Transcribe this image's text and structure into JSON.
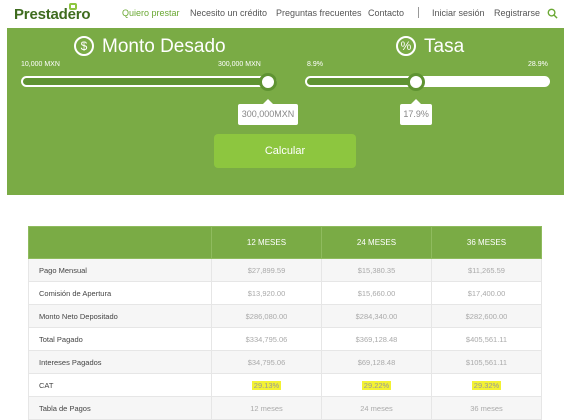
{
  "nav": {
    "logo": "Prestadero",
    "links": [
      "Quiero prestar",
      "Necesito un crédito",
      "Preguntas frecuentes",
      "Contacto"
    ],
    "login": "Iniciar sesión",
    "register": "Registrarse"
  },
  "monto": {
    "title": "Monto Desado",
    "min_label": "10,000 MXN",
    "max_label": "300,000 MXN",
    "value": "300,000MXN",
    "level": 1.0
  },
  "tasa": {
    "title": "Tasa",
    "min_label": "8.9%",
    "max_label": "28.9%",
    "value": "17.9%",
    "level": 0.45
  },
  "calculate_label": "Calcular",
  "table": {
    "headers": [
      "",
      "12 MESES",
      "24 MESES",
      "36 MESES"
    ],
    "rows": [
      {
        "label": "Pago Mensual",
        "values": [
          "$27,899.59",
          "$15,380.35",
          "$11,265.59"
        ]
      },
      {
        "label": "Comisión de Apertura",
        "values": [
          "$13,920.00",
          "$15,660.00",
          "$17,400.00"
        ]
      },
      {
        "label": "Monto Neto Depositado",
        "values": [
          "$286,080.00",
          "$284,340.00",
          "$282,600.00"
        ]
      },
      {
        "label": "Total Pagado",
        "values": [
          "$334,795.06",
          "$369,128.48",
          "$405,561.11"
        ]
      },
      {
        "label": "Intereses Pagados",
        "values": [
          "$34,795.06",
          "$69,128.48",
          "$105,561.11"
        ]
      },
      {
        "label": "CAT",
        "values": [
          "29.13%",
          "29.22%",
          "29.32%"
        ]
      },
      {
        "label": "Tabla de Pagos",
        "values": [
          "12 meses",
          "24 meses",
          "36 meses"
        ]
      }
    ]
  },
  "colors": {
    "panel": "#7aab45",
    "button": "#8dc63f",
    "highlight": "#f3f233"
  },
  "icons": {
    "monto": "dollar-icon",
    "tasa": "percent-icon",
    "search": "search-icon"
  }
}
